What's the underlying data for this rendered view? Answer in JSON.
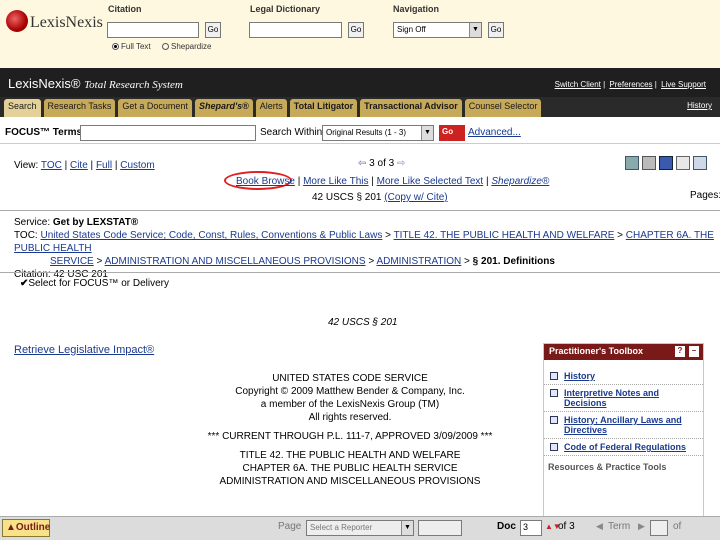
{
  "top": {
    "logo_text": "LexisNexis",
    "citation": {
      "label": "Citation",
      "go": "Go",
      "radio_full": "Full Text",
      "radio_shep": "Shepardize"
    },
    "dictionary": {
      "label": "Legal Dictionary",
      "go": "Go"
    },
    "navigation": {
      "label": "Navigation",
      "select": "Sign Off",
      "go": "Go"
    }
  },
  "header": {
    "brand": "LexisNexis®",
    "brand_sub": "Total Research System",
    "links": [
      "Switch Client",
      "Preferences",
      "Live Support"
    ],
    "history": "History"
  },
  "tabs": [
    "Search",
    "Research Tasks",
    "Get a Document",
    "Shepard's®",
    "Alerts",
    "Total Litigator",
    "Transactional Advisor",
    "Counsel Selector"
  ],
  "focus": {
    "label": "FOCUS™ Terms",
    "search_within": "Search Within",
    "select": "Original Results (1 - 3)",
    "go": "Go",
    "advanced": "Advanced..."
  },
  "view": {
    "label": "View:",
    "options": [
      "TOC",
      "Cite",
      "Full",
      "Custom"
    ],
    "nav": "3 of 3",
    "pages": "Pages:"
  },
  "doc_links": [
    "Book Browse",
    "More Like This",
    "More Like Selected Text",
    "Shepardize®"
  ],
  "cite_line": {
    "text": "42 USCS § 201",
    "link": "(Copy w/ Cite)"
  },
  "service": {
    "label": "Service:",
    "value": "Get by LEXSTAT®",
    "toc_label": "TOC:",
    "toc_1": "United States Code Service; Code, Const, Rules, Conventions & Public Laws",
    "toc_2": "TITLE 42. THE PUBLIC HEALTH AND WELFARE",
    "toc_3": "CHAPTER 6A. THE PUBLIC HEALTH",
    "toc_4": "SERVICE",
    "toc_5": "ADMINISTRATION AND MISCELLANEOUS PROVISIONS",
    "toc_6": "ADMINISTRATION",
    "toc_7": "§ 201. Definitions",
    "citation_label": "Citation:",
    "citation": "42 USC 201"
  },
  "select_focus": "Select for FOCUS™ or Delivery",
  "doc_cite": "42 USCS § 201",
  "retrieve": "Retrieve Legislative Impact®",
  "body": [
    "UNITED STATES CODE SERVICE",
    "Copyright © 2009 Matthew Bender & Company, Inc.",
    "a member of the LexisNexis Group (TM)",
    "All rights reserved.",
    "*** CURRENT THROUGH P.L. 111-7, APPROVED 3/09/2009 ***",
    "TITLE 42. THE PUBLIC HEALTH AND WELFARE",
    "CHAPTER 6A. THE PUBLIC HEALTH SERVICE",
    "ADMINISTRATION AND MISCELLANEOUS PROVISIONS"
  ],
  "toolbox": {
    "title": "Practitioner's Toolbox",
    "items": [
      "History",
      "Interpretive Notes and Decisions",
      "History; Ancillary Laws and Directives",
      "Code of Federal Regulations"
    ],
    "footer": "Resources & Practice Tools"
  },
  "bottom": {
    "outline": "Outline",
    "page_label": "Page",
    "reporter_select": "Select a Reporter",
    "doc_label": "Doc",
    "doc_num": "3",
    "doc_total": "of 3",
    "term_label": "Term",
    "term_of": "of"
  },
  "colors": {
    "header": "#1f1f1f",
    "tab": "#c7a95a",
    "toolbox_head": "#7a1a18",
    "link": "#1a3a8f",
    "highlight": "#e02020"
  }
}
